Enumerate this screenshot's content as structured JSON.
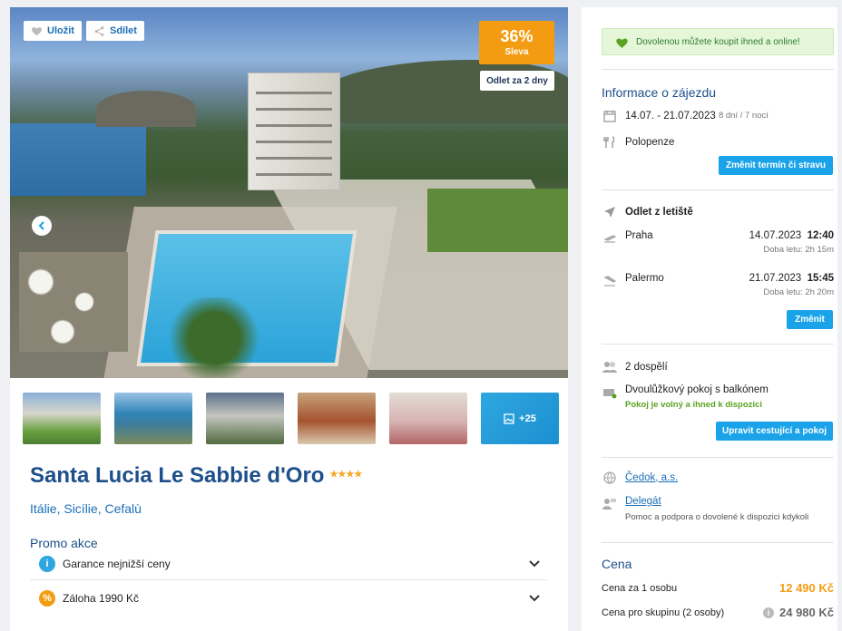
{
  "gallery": {
    "save_label": "Uložit",
    "share_label": "Sdílet",
    "discount_pct": "36%",
    "discount_label": "Sleva",
    "departure_badge": "Odlet za 2 dny",
    "more_photos": "+25"
  },
  "hotel": {
    "name": "Santa Lucia Le Sabbie d'Oro",
    "stars": "★★★★",
    "location": "Itálie, Sicílie, Cefalù"
  },
  "promo": {
    "heading": "Promo akce",
    "items": [
      {
        "label": "Garance nejnižší ceny",
        "icon": "info-icon",
        "color": "#2ea7e0"
      },
      {
        "label": "Záloha 1990 Kč",
        "icon": "percent-icon",
        "color": "#f39c12"
      }
    ]
  },
  "sidebar": {
    "banner": "Dovolenou můžete koupit ihned a online!",
    "info_heading": "Informace o zájezdu",
    "dates": "14.07. - 21.07.2023",
    "duration": "8 dní / 7 nocí",
    "board": "Polopenze",
    "change_date_btn": "Změnit termín či stravu",
    "departure_heading": "Odlet z letiště",
    "flights": [
      {
        "city": "Praha",
        "date": "14.07.2023",
        "time": "12:40",
        "duration": "Doba letu: 2h 15m"
      },
      {
        "city": "Palermo",
        "date": "21.07.2023",
        "time": "15:45",
        "duration": "Doba letu: 2h 20m"
      }
    ],
    "change_btn": "Změnit",
    "travelers": "2 dospělí",
    "room": "Dvoulůžkový pokoj s balkónem",
    "room_status": "Pokoj je volný a ihned k dispozici",
    "edit_travelers_btn": "Upravit cestující a pokoj",
    "agency": "Čedok, a.s.",
    "delegate": "Delegát",
    "delegate_note": "Pomoc a podpora o dovolené k dispozici kdykoli",
    "price_heading": "Cena",
    "price_per_person_label": "Cena za 1 osobu",
    "price_per_person": "12 490 Kč",
    "price_group_label": "Cena pro skupinu (2 osoby)",
    "price_group": "24 980 Kč"
  }
}
